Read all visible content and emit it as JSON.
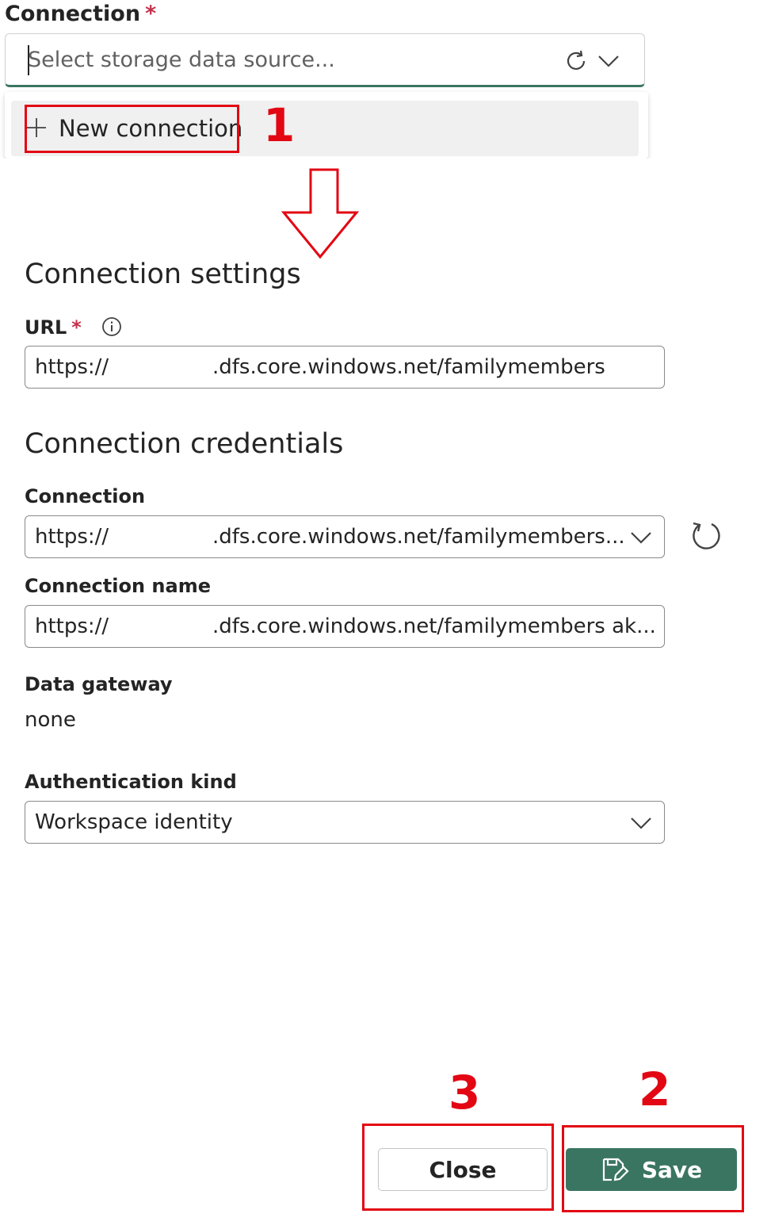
{
  "top_connection": {
    "label": "Connection",
    "required_mark": "*",
    "placeholder": "Select storage data source...",
    "icons": [
      "refresh-icon",
      "chevron-down-icon"
    ]
  },
  "dropdown_menu": {
    "new_connection_label": "New connection"
  },
  "annotations": {
    "step1": "1",
    "step2": "2",
    "step3": "3",
    "highlight_color": "#e30613"
  },
  "connection_settings": {
    "heading": "Connection settings",
    "url_label": "URL",
    "url_required": "*",
    "url_prefix": "https://",
    "url_suffix": ".dfs.core.windows.net/familymembers"
  },
  "connection_credentials": {
    "heading": "Connection credentials",
    "connection_label": "Connection",
    "connection_prefix": "https://",
    "connection_suffix": ".dfs.core.windows.net/familymembers...",
    "connection_name_label": "Connection name",
    "connection_name_prefix": "https://",
    "connection_name_suffix": ".dfs.core.windows.net/familymembers ak...",
    "gateway_label": "Data gateway",
    "gateway_value": "none",
    "auth_label": "Authentication kind",
    "auth_value": "Workspace identity"
  },
  "footer": {
    "close_label": "Close",
    "save_label": "Save",
    "save_color": "#3a7562"
  }
}
